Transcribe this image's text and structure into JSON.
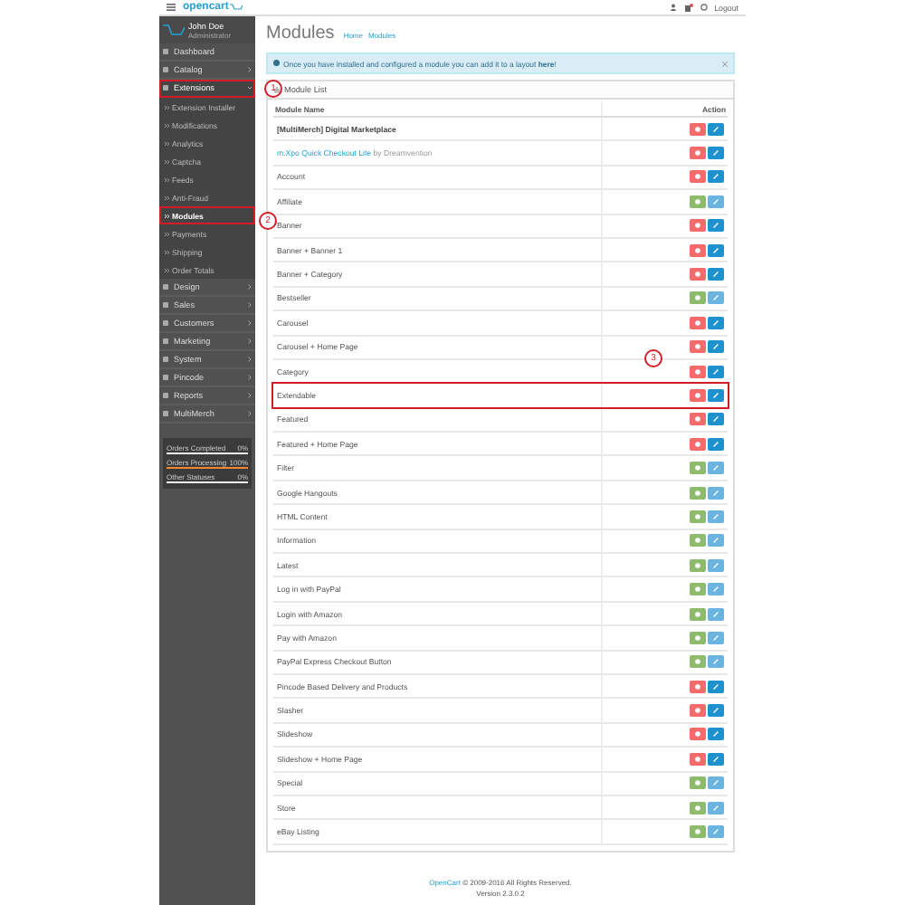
{
  "header": {
    "logo": "opencart",
    "logout": "Logout"
  },
  "profile": {
    "name": "John Doe",
    "role": "Administrator"
  },
  "menu": [
    {
      "label": "Dashboard",
      "expanded": false,
      "marked": false
    },
    {
      "label": "Catalog",
      "expanded": false,
      "marked": false
    },
    {
      "label": "Extensions",
      "expanded": true,
      "marked": true,
      "children": [
        {
          "label": "Extension Installer",
          "selected": false,
          "marked": false
        },
        {
          "label": "Modifications",
          "selected": false,
          "marked": false
        },
        {
          "label": "Analytics",
          "selected": false,
          "marked": false
        },
        {
          "label": "Captcha",
          "selected": false,
          "marked": false
        },
        {
          "label": "Feeds",
          "selected": false,
          "marked": false
        },
        {
          "label": "Anti-Fraud",
          "selected": false,
          "marked": false
        },
        {
          "label": "Modules",
          "selected": true,
          "marked": true
        },
        {
          "label": "Payments",
          "selected": false,
          "marked": false
        },
        {
          "label": "Shipping",
          "selected": false,
          "marked": false
        },
        {
          "label": "Order Totals",
          "selected": false,
          "marked": false
        }
      ]
    },
    {
      "label": "Design",
      "expanded": false,
      "marked": false
    },
    {
      "label": "Sales",
      "expanded": false,
      "marked": false
    },
    {
      "label": "Customers",
      "expanded": false,
      "marked": false
    },
    {
      "label": "Marketing",
      "expanded": false,
      "marked": false
    },
    {
      "label": "System",
      "expanded": false,
      "marked": false
    },
    {
      "label": "Pincode",
      "expanded": false,
      "marked": false
    },
    {
      "label": "Reports",
      "expanded": false,
      "marked": false
    },
    {
      "label": "MultiMerch",
      "expanded": false,
      "marked": false
    }
  ],
  "stats": [
    {
      "label": "Orders Completed",
      "value": "0%",
      "level": 0
    },
    {
      "label": "Orders Processing",
      "value": "100%",
      "level": 1
    },
    {
      "label": "Other Statuses",
      "value": "0%",
      "level": 0
    }
  ],
  "page": {
    "title": "Modules",
    "breadcrumbs": [
      "Home",
      "Modules"
    ],
    "alert": "Once you have installed and configured a module you can add it to a layout **here**!",
    "panel_title": "Module List"
  },
  "table": {
    "columns": [
      "Module Name",
      "Action"
    ],
    "rows": [
      {
        "name": "[MultiMerch] Digital Marketplace",
        "kind": "featured",
        "installed": true,
        "marked": false
      },
      {
        "name": "m.Xpo Quick Checkout Lite",
        "by": "by Dreamvention",
        "kind": "linked",
        "installed": true,
        "marked": false
      },
      {
        "name": "Account",
        "kind": "standard",
        "installed": true,
        "marked": false
      },
      {
        "name": "Affiliate",
        "kind": "standard",
        "installed": false,
        "marked": false
      },
      {
        "name": "Banner",
        "kind": "standard",
        "installed": true,
        "marked": false
      },
      {
        "name": "Banner + Banner 1",
        "kind": "standard",
        "installed": true,
        "marked": false
      },
      {
        "name": "Banner + Category",
        "kind": "standard",
        "installed": true,
        "marked": false
      },
      {
        "name": "Bestseller",
        "kind": "standard",
        "installed": false,
        "marked": false
      },
      {
        "name": "Carousel",
        "kind": "standard",
        "installed": true,
        "marked": false
      },
      {
        "name": "Carousel + Home Page",
        "kind": "standard",
        "installed": true,
        "marked": false
      },
      {
        "name": "Category",
        "kind": "standard",
        "installed": true,
        "marked": false
      },
      {
        "name": "Extendable",
        "kind": "standard",
        "installed": true,
        "marked": true
      },
      {
        "name": "Featured",
        "kind": "standard",
        "installed": true,
        "marked": false
      },
      {
        "name": "Featured + Home Page",
        "kind": "standard",
        "installed": true,
        "marked": false
      },
      {
        "name": "Filter",
        "kind": "standard",
        "installed": false,
        "marked": false
      },
      {
        "name": "Google Hangouts",
        "kind": "standard",
        "installed": false,
        "marked": false
      },
      {
        "name": "HTML Content",
        "kind": "standard",
        "installed": false,
        "marked": false
      },
      {
        "name": "Information",
        "kind": "standard",
        "installed": false,
        "marked": false
      },
      {
        "name": "Latest",
        "kind": "standard",
        "installed": false,
        "marked": false
      },
      {
        "name": "Log in with PayPal",
        "kind": "standard",
        "installed": false,
        "marked": false
      },
      {
        "name": "Login with Amazon",
        "kind": "standard",
        "installed": false,
        "marked": false
      },
      {
        "name": "Pay with Amazon",
        "kind": "standard",
        "installed": false,
        "marked": false
      },
      {
        "name": "PayPal Express Checkout Button",
        "kind": "standard",
        "installed": false,
        "marked": false
      },
      {
        "name": "Pincode Based Delivery and Products",
        "kind": "standard",
        "installed": true,
        "marked": false
      },
      {
        "name": "Slasher",
        "kind": "standard",
        "installed": true,
        "marked": false
      },
      {
        "name": "Slideshow",
        "kind": "standard",
        "installed": true,
        "marked": false
      },
      {
        "name": "Slideshow + Home Page",
        "kind": "standard",
        "installed": true,
        "marked": false
      },
      {
        "name": "Special",
        "kind": "standard",
        "installed": false,
        "marked": false
      },
      {
        "name": "Store",
        "kind": "standard",
        "installed": false,
        "marked": false
      },
      {
        "name": "eBay Listing",
        "kind": "standard",
        "installed": false,
        "marked": false
      }
    ]
  },
  "footer": {
    "link": "OpenCart",
    "copyright": "© 2009-2016 All Rights Reserved.",
    "version": "Version 2.3.0.2"
  },
  "annotations": [
    "1",
    "2",
    "3"
  ]
}
